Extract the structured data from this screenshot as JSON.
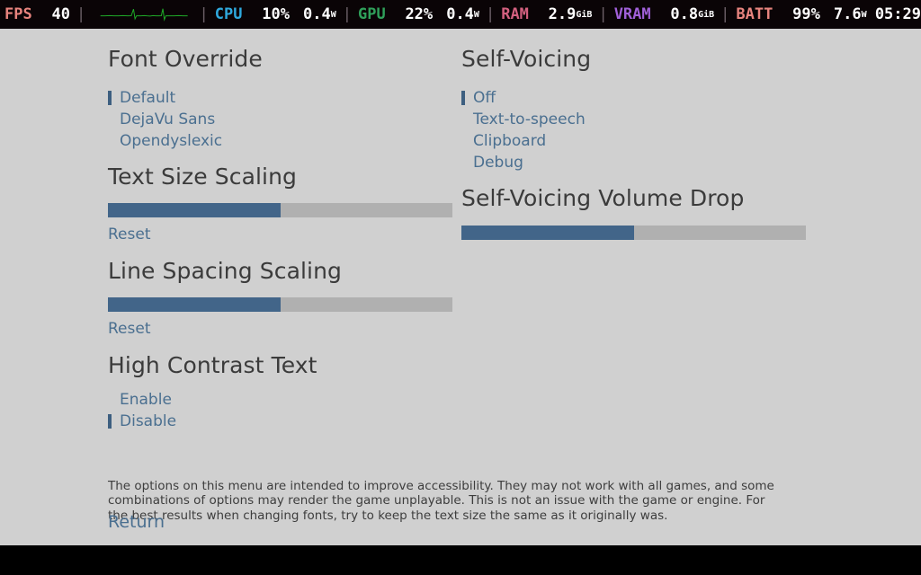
{
  "hud": {
    "fps": {
      "label": "FPS",
      "value": "40",
      "color": "#e8847e"
    },
    "graph": {
      "name": "frametime-graph",
      "color": "#1faa28"
    },
    "cpu": {
      "label": "CPU",
      "color": "#2fa9dd",
      "usage": "10%",
      "power": "0.4",
      "power_unit": "W"
    },
    "gpu": {
      "label": "GPU",
      "color": "#2fa05a",
      "usage": "22%",
      "power": "0.4",
      "power_unit": "W"
    },
    "ram": {
      "label": "RAM",
      "color": "#d3607f",
      "value": "2.9",
      "unit": "GiB"
    },
    "vram": {
      "label": "VRAM",
      "color": "#a060d8",
      "value": "0.8",
      "unit": "GiB"
    },
    "batt": {
      "label": "BATT",
      "color": "#e8847e",
      "percent": "99%",
      "power": "7.6",
      "power_unit": "W",
      "time": "05:29"
    },
    "separator": "|"
  },
  "menu": {
    "left": {
      "font_override": {
        "title": "Font Override",
        "options": [
          {
            "label": "Default",
            "selected": true
          },
          {
            "label": "DejaVu Sans",
            "selected": false
          },
          {
            "label": "Opendyslexic",
            "selected": false
          }
        ]
      },
      "text_size_scaling": {
        "title": "Text Size Scaling",
        "slider_percent": 50,
        "reset_label": "Reset"
      },
      "line_spacing_scaling": {
        "title": "Line Spacing Scaling",
        "slider_percent": 50,
        "reset_label": "Reset"
      },
      "high_contrast_text": {
        "title": "High Contrast Text",
        "options": [
          {
            "label": "Enable",
            "selected": false
          },
          {
            "label": "Disable",
            "selected": true
          }
        ]
      }
    },
    "right": {
      "self_voicing": {
        "title": "Self-Voicing",
        "options": [
          {
            "label": "Off",
            "selected": true
          },
          {
            "label": "Text-to-speech",
            "selected": false
          },
          {
            "label": "Clipboard",
            "selected": false
          },
          {
            "label": "Debug",
            "selected": false
          }
        ]
      },
      "self_voicing_volume_drop": {
        "title": "Self-Voicing Volume Drop",
        "slider_percent": 50
      }
    },
    "help_text": "The options on this menu are intended to improve accessibility. They may not work with all games, and some combinations of options may render the game unplayable. This is not an issue with the game or engine. For the best results when changing fonts, try to keep the text size the same as it originally was.",
    "return_label": "Return"
  },
  "colors": {
    "panel_bg": "#d0d0d0",
    "accent_blue": "#4a6f90",
    "slider_fill": "#426589",
    "slider_track": "#b0b0b0",
    "heading": "#3b3b3b",
    "hud_bg": "#0a0406"
  }
}
